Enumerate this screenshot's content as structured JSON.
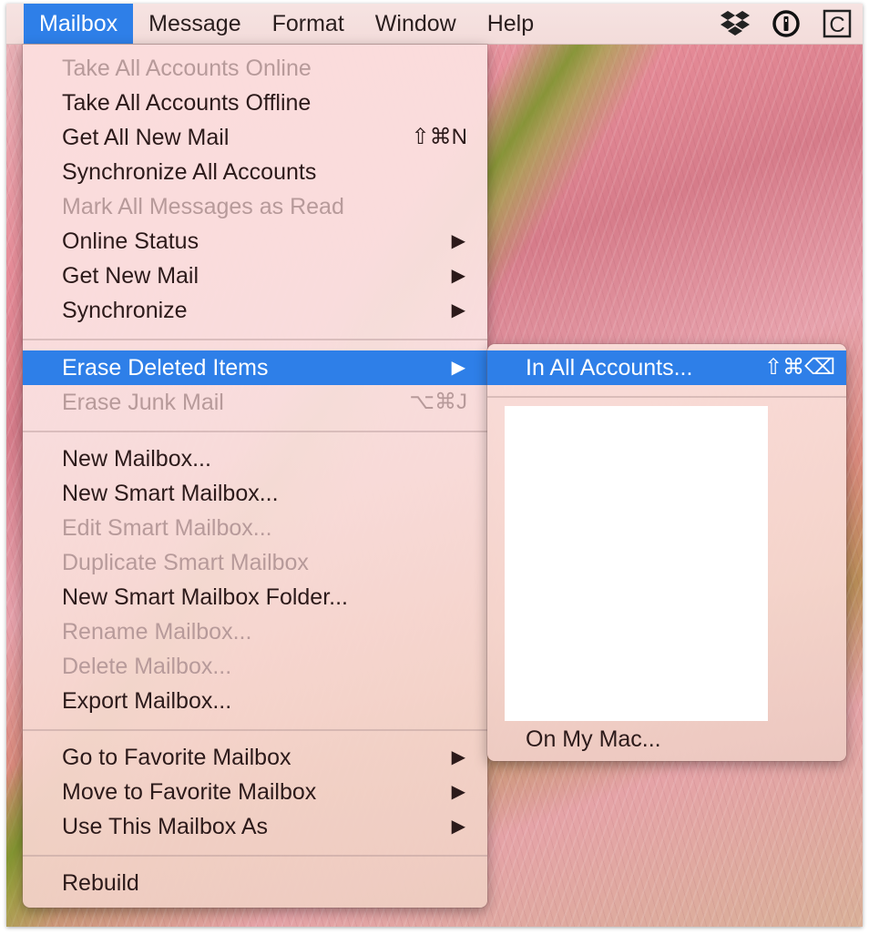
{
  "menubar": {
    "items": [
      {
        "label": "Mailbox",
        "active": true
      },
      {
        "label": "Message",
        "active": false
      },
      {
        "label": "Format",
        "active": false
      },
      {
        "label": "Window",
        "active": false
      },
      {
        "label": "Help",
        "active": false
      }
    ],
    "status_icons": [
      "dropbox-icon",
      "1password-icon",
      "c-app-icon"
    ],
    "status_icon_text": {
      "c": "C"
    },
    "accent_color": "#2e7fe8"
  },
  "mailbox_menu": {
    "items": [
      {
        "label": "Take All Accounts Online",
        "enabled": false
      },
      {
        "label": "Take All Accounts Offline",
        "enabled": true
      },
      {
        "label": "Get All New Mail",
        "enabled": true,
        "shortcut": "⇧⌘N"
      },
      {
        "label": "Synchronize All Accounts",
        "enabled": true
      },
      {
        "label": "Mark All Messages as Read",
        "enabled": false
      },
      {
        "label": "Online Status",
        "enabled": true,
        "submenu": true,
        "arrow": "▶"
      },
      {
        "label": "Get New Mail",
        "enabled": true,
        "submenu": true,
        "arrow": "▶"
      },
      {
        "label": "Synchronize",
        "enabled": true,
        "submenu": true,
        "arrow": "▶"
      },
      {
        "label": "Erase Deleted Items",
        "enabled": true,
        "submenu": true,
        "highlighted": true,
        "arrow": "▶"
      },
      {
        "label": "Erase Junk Mail",
        "enabled": false,
        "shortcut": "⌥⌘J"
      },
      {
        "label": "New Mailbox...",
        "enabled": true
      },
      {
        "label": "New Smart Mailbox...",
        "enabled": true
      },
      {
        "label": "Edit Smart Mailbox...",
        "enabled": false
      },
      {
        "label": "Duplicate Smart Mailbox",
        "enabled": false
      },
      {
        "label": "New Smart Mailbox Folder...",
        "enabled": true
      },
      {
        "label": "Rename Mailbox...",
        "enabled": false
      },
      {
        "label": "Delete Mailbox...",
        "enabled": false
      },
      {
        "label": "Export Mailbox...",
        "enabled": true
      },
      {
        "label": "Go to Favorite Mailbox",
        "enabled": true,
        "submenu": true,
        "arrow": "▶"
      },
      {
        "label": "Move to Favorite Mailbox",
        "enabled": true,
        "submenu": true,
        "arrow": "▶"
      },
      {
        "label": "Use This Mailbox As",
        "enabled": true,
        "submenu": true,
        "arrow": "▶"
      },
      {
        "label": "Rebuild",
        "enabled": true
      }
    ]
  },
  "erase_submenu": {
    "items": [
      {
        "label": "In All Accounts...",
        "enabled": true,
        "highlighted": true,
        "shortcut": "⇧⌘⌫"
      },
      {
        "label": "On My Mac...",
        "enabled": true
      }
    ]
  }
}
